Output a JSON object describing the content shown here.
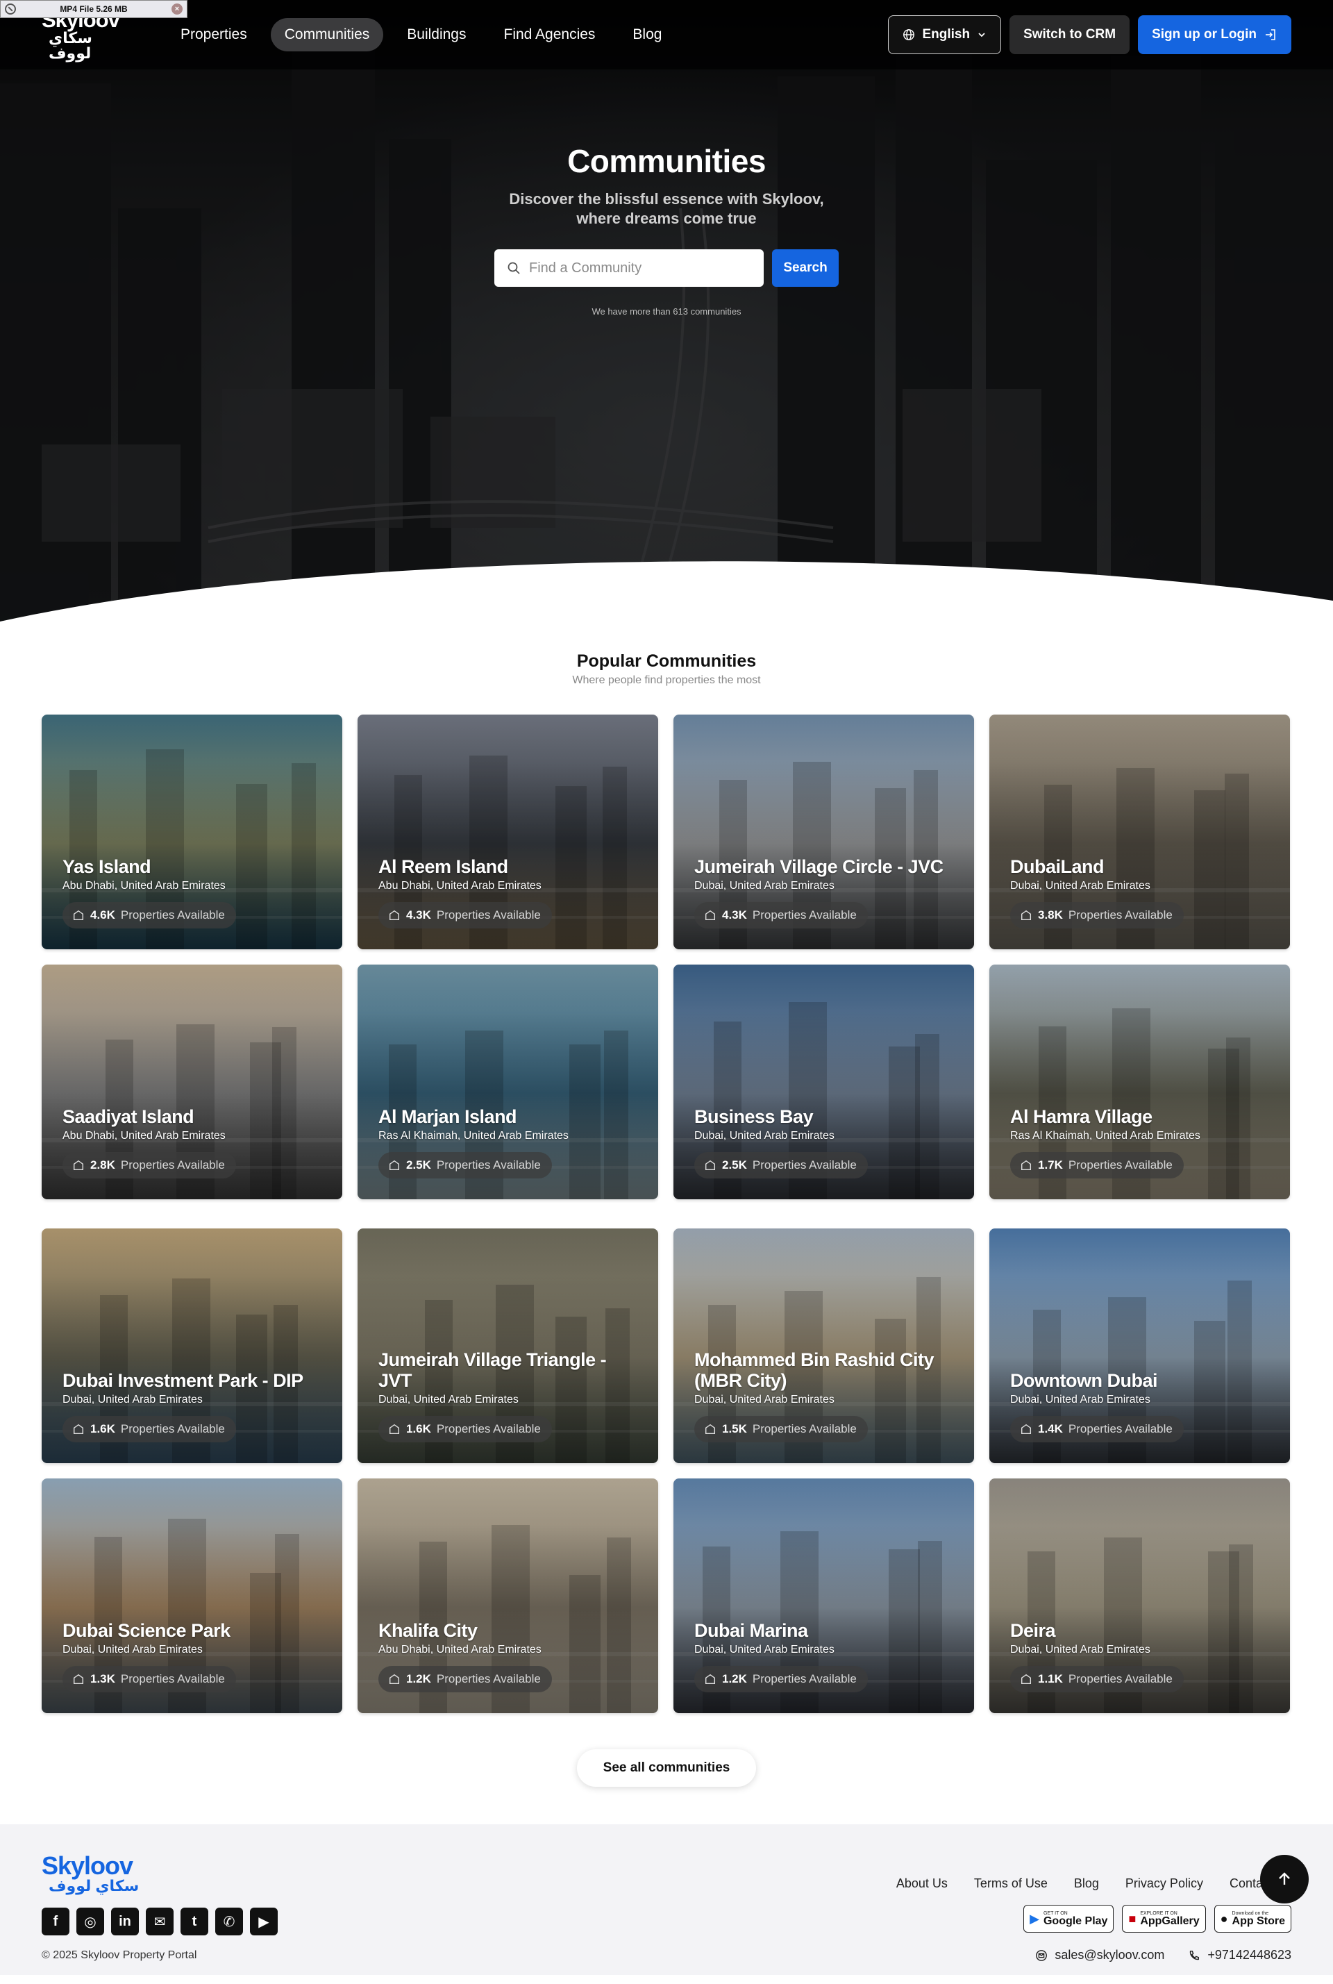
{
  "file_badge": {
    "text": "MP4 File 5.26 MB"
  },
  "logo": {
    "en": "Skyloov",
    "ar": "سكاي لووف"
  },
  "nav": {
    "items": [
      "Properties",
      "Communities",
      "Buildings",
      "Find Agencies",
      "Blog"
    ],
    "active": "Communities"
  },
  "header": {
    "language": "English",
    "crm_label": "Switch to CRM",
    "login_label": "Sign up or Login"
  },
  "hero": {
    "title": "Communities",
    "subtitle": "Discover the blissful essence with Skyloov, where dreams come true",
    "search_placeholder": "Find a Community",
    "search_button": "Search",
    "note": "We have more than 613 communities"
  },
  "popular": {
    "title": "Popular Communities",
    "tagline": "Where people find properties the most",
    "properties_label": "Properties Available",
    "cards": [
      {
        "name": "Yas Island",
        "location": "Abu Dhabi, United Arab Emirates",
        "count": "4.6K",
        "theme": [
          "#3d6a7a",
          "#8a8f6a",
          "#1f4c63"
        ]
      },
      {
        "name": "Al Reem Island",
        "location": "Abu Dhabi, United Arab Emirates",
        "count": "4.3K",
        "theme": [
          "#6f7480",
          "#3c4148",
          "#8c7a5c"
        ]
      },
      {
        "name": "Jumeirah Village Circle - JVC",
        "location": "Dubai, United Arab Emirates",
        "count": "4.3K",
        "theme": [
          "#6a85a0",
          "#a7a9ab",
          "#4d5053"
        ]
      },
      {
        "name": "DubaiLand",
        "location": "Dubai, United Arab Emirates",
        "count": "3.8K",
        "theme": [
          "#9a9080",
          "#6c6558",
          "#807a6e"
        ]
      },
      {
        "name": "Saadiyat Island",
        "location": "Abu Dhabi, United Arab Emirates",
        "count": "2.8K",
        "theme": [
          "#b6a48a",
          "#8c8c8c",
          "#4a4a4a"
        ]
      },
      {
        "name": "Al Marjan Island",
        "location": "Ras Al Khaimah, United Arab Emirates",
        "count": "2.5K",
        "theme": [
          "#6b8fa0",
          "#3b6a84",
          "#9fb3b8"
        ]
      },
      {
        "name": "Business Bay",
        "location": "Dubai, United Arab Emirates",
        "count": "2.5K",
        "theme": [
          "#3a5f86",
          "#7c8ea4",
          "#3a3d44"
        ]
      },
      {
        "name": "Al Hamra Village",
        "location": "Ras Al Khaimah, United Arab Emirates",
        "count": "1.7K",
        "theme": [
          "#9aa8b3",
          "#6b6b5c",
          "#c3b79e"
        ]
      },
      {
        "name": "Dubai Investment Park - DIP",
        "location": "Dubai, United Arab Emirates",
        "count": "1.6K",
        "theme": [
          "#b09870",
          "#6d6a58",
          "#3d5f7a"
        ]
      },
      {
        "name": "Jumeirah Village Triangle - JVT",
        "location": "Dubai, United Arab Emirates",
        "count": "1.6K",
        "theme": [
          "#6d6a5a",
          "#8a8470",
          "#4f5a4d"
        ]
      },
      {
        "name": "Mohammed Bin Rashid City (MBR City)",
        "location": "Dubai, United Arab Emirates",
        "count": "1.5K",
        "theme": [
          "#9ba7b3",
          "#b9a888",
          "#5e7a8a"
        ]
      },
      {
        "name": "Downtown Dubai",
        "location": "Dubai, United Arab Emirates",
        "count": "1.4K",
        "theme": [
          "#4a74a3",
          "#9cb1c4",
          "#3a3f47"
        ]
      },
      {
        "name": "Dubai Science Park",
        "location": "Dubai, United Arab Emirates",
        "count": "1.3K",
        "theme": [
          "#8fa6ba",
          "#b3916a",
          "#5c6a74"
        ]
      },
      {
        "name": "Khalifa City",
        "location": "Abu Dhabi, United Arab Emirates",
        "count": "1.2K",
        "theme": [
          "#b5aa96",
          "#8a806f",
          "#d0c6b2"
        ]
      },
      {
        "name": "Dubai Marina",
        "location": "Dubai, United Arab Emirates",
        "count": "1.2K",
        "theme": [
          "#5b7fa6",
          "#9aa8b6",
          "#3b3f48"
        ]
      },
      {
        "name": "Deira",
        "location": "Dubai, United Arab Emirates",
        "count": "1.1K",
        "theme": [
          "#8f8a82",
          "#b2a992",
          "#5a5852"
        ]
      }
    ],
    "see_all": "See all communities"
  },
  "footer": {
    "logo_en": "Skyloov",
    "logo_ar": "سكاي لووف",
    "links": [
      "About Us",
      "Terms of Use",
      "Blog",
      "Privacy Policy",
      "Contact Us"
    ],
    "stores": [
      {
        "small": "GET IT ON",
        "big": "Google Play",
        "icon": "play-icon"
      },
      {
        "small": "EXPLORE IT ON",
        "big": "AppGallery",
        "icon": "appgallery-icon"
      },
      {
        "small": "Download on the",
        "big": "App Store",
        "icon": "apple-icon"
      }
    ],
    "social": [
      "facebook-icon",
      "instagram-icon",
      "linkedin-icon",
      "mail-icon",
      "twitter-icon",
      "whatsapp-icon",
      "youtube-icon"
    ],
    "copyright": "© 2025 Skyloov Property Portal",
    "email": "sales@skyloov.com",
    "phone": "+97142448623"
  },
  "colors": {
    "accent": "#1565e0",
    "dark": "#111111",
    "footer_bg": "#f3f3f6"
  }
}
